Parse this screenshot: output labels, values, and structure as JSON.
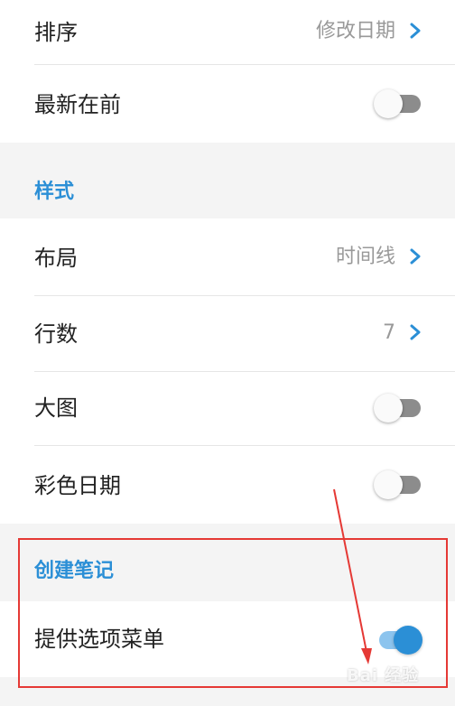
{
  "settings": {
    "sort_row": {
      "label": "排序",
      "value": "修改日期",
      "icon": "chevron-right-icon"
    },
    "newest_first_row": {
      "label": "最新在前",
      "toggle_on": false
    },
    "style_section": {
      "title": "样式"
    },
    "layout_row": {
      "label": "布局",
      "value": "时间线",
      "icon": "chevron-right-icon"
    },
    "lines_row": {
      "label": "行数",
      "value": "7",
      "icon": "chevron-right-icon"
    },
    "big_image_row": {
      "label": "大图",
      "toggle_on": false
    },
    "color_date_row": {
      "label": "彩色日期",
      "toggle_on": false
    },
    "create_note_section": {
      "title": "创建笔记"
    },
    "option_menu_row": {
      "label": "提供选项菜单",
      "toggle_on": true
    }
  },
  "annotation": {
    "highlight_color": "#e53935",
    "watermark": "Bai 经验"
  },
  "colors": {
    "accent": "#2b8fd6",
    "background": "#f4f4f4",
    "row_background": "#ffffff"
  }
}
